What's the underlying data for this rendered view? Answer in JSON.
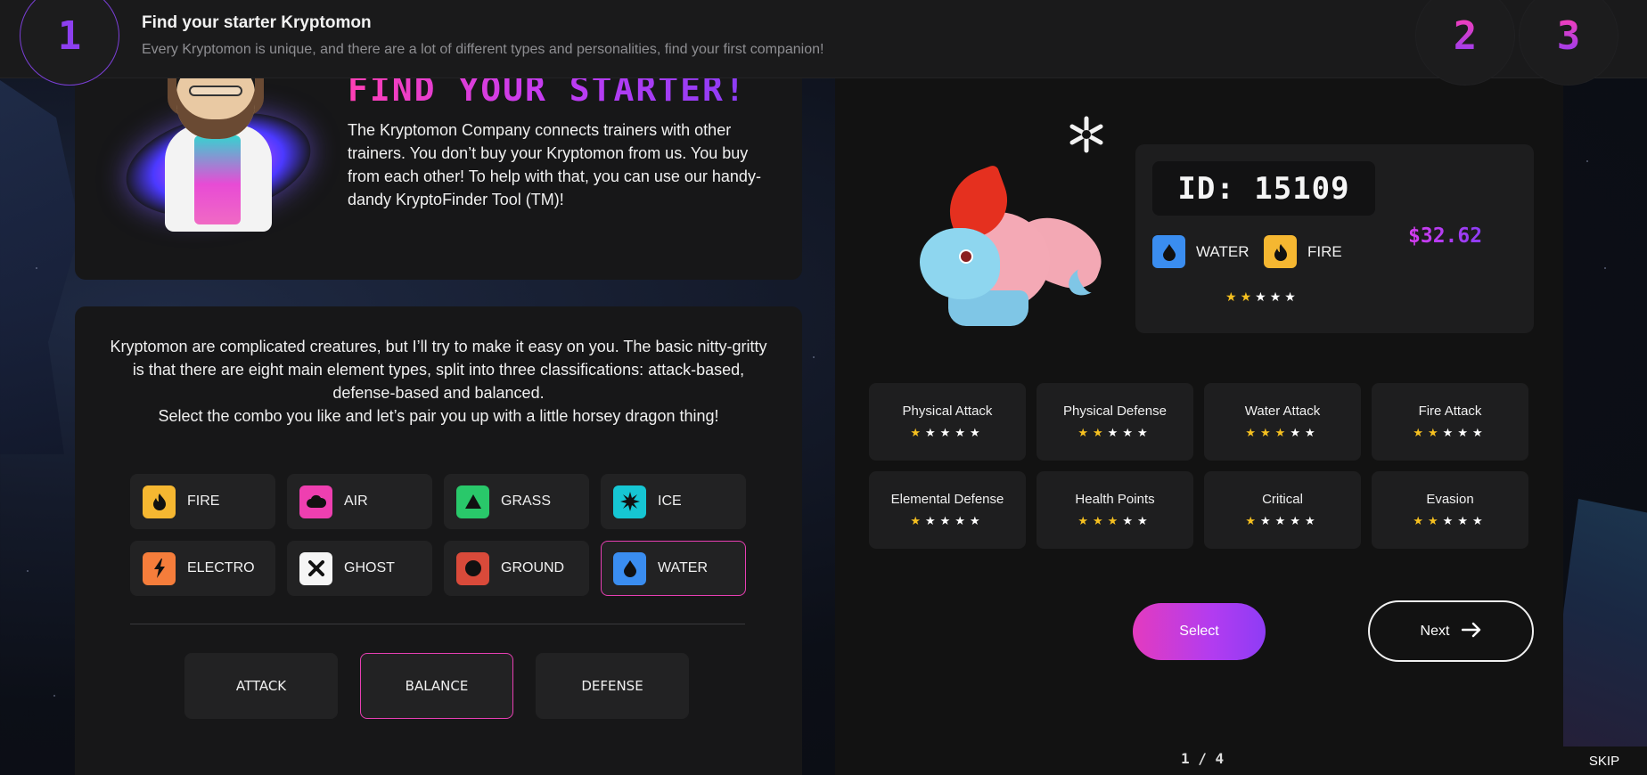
{
  "header": {
    "steps": [
      "1",
      "2",
      "3"
    ],
    "title": "Find your starter Kryptomon",
    "subtitle": "Every Kryptomon is unique, and there are a lot of different types and personalities, find your first companion!"
  },
  "intro": {
    "heading": "FIND YOUR STARTER!",
    "text": "The Kryptomon Company connects trainers with other trainers. You don’t buy your Kryptomon from us. You buy from each other! To help with that, you can use our handy-dandy KryptoFinder Tool (TM)!"
  },
  "selector": {
    "description_line1": "Kryptomon are complicated creatures, but I’ll try to make it easy on you. The basic nitty-gritty is that there are eight main element types, split into three classifications: attack-based, defense-based and balanced.",
    "description_line2": "Select the combo you like and let’s pair you up with a little horsey dragon thing!",
    "types": [
      {
        "label": "FIRE",
        "icon": "flame-icon",
        "color": "#f5b731",
        "selected": false
      },
      {
        "label": "AIR",
        "icon": "cloud-icon",
        "color": "#ee3fb0",
        "selected": false
      },
      {
        "label": "GRASS",
        "icon": "triangle-icon",
        "color": "#29c86a",
        "selected": false
      },
      {
        "label": "ICE",
        "icon": "spike-icon",
        "color": "#16c6d3",
        "selected": false
      },
      {
        "label": "ELECTRO",
        "icon": "bolt-icon",
        "color": "#f57d3b",
        "selected": false
      },
      {
        "label": "GHOST",
        "icon": "cross-icon",
        "color": "#f5f5f5",
        "selected": false
      },
      {
        "label": "GROUND",
        "icon": "circle-icon",
        "color": "#d94a3a",
        "selected": false
      },
      {
        "label": "WATER",
        "icon": "drop-icon",
        "color": "#3a8df0",
        "selected": true
      }
    ],
    "classes": [
      {
        "label": "ATTACK",
        "selected": false
      },
      {
        "label": "BALANCE",
        "selected": true
      },
      {
        "label": "DEFENSE",
        "selected": false
      }
    ]
  },
  "kryptomon": {
    "id": "ID: 15109",
    "price": "$32.62",
    "element_icon": "snowflake-icon",
    "types": [
      {
        "label": "WATER",
        "icon": "drop-icon",
        "color": "#3a8df0"
      },
      {
        "label": "FIRE",
        "icon": "flame-icon",
        "color": "#f5b731"
      }
    ],
    "rating": 2,
    "stats": [
      {
        "label": "Physical Attack",
        "rating": 1
      },
      {
        "label": "Physical Defense",
        "rating": 2
      },
      {
        "label": "Water Attack",
        "rating": 3
      },
      {
        "label": "Fire Attack",
        "rating": 2
      },
      {
        "label": "Elemental Defense",
        "rating": 1
      },
      {
        "label": "Health Points",
        "rating": 3
      },
      {
        "label": "Critical",
        "rating": 1
      },
      {
        "label": "Evasion",
        "rating": 2
      }
    ],
    "max_rating": 5
  },
  "actions": {
    "select_label": "Select",
    "next_label": "Next",
    "pager": "1 / 4",
    "skip_label": "SKIP"
  }
}
